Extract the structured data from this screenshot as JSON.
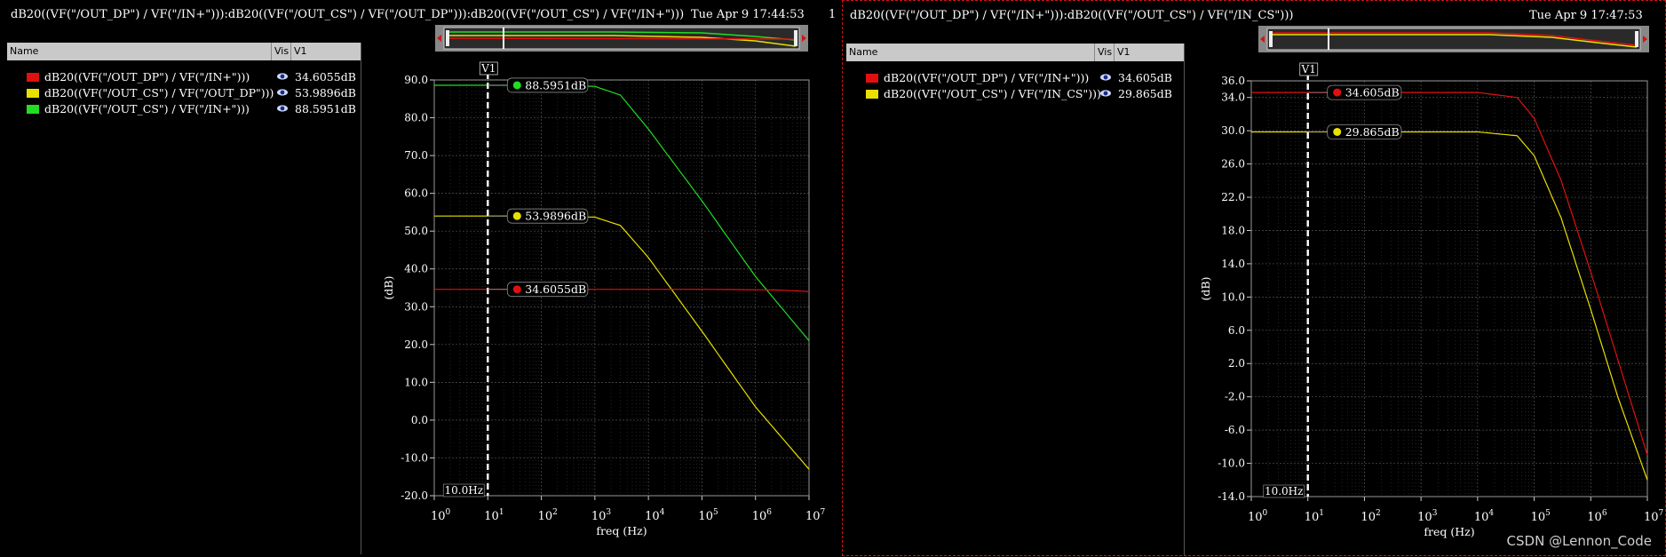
{
  "left": {
    "title": "dB20((VF(\"/OUT_DP\") / VF(\"/IN+\"))):dB20((VF(\"/OUT_CS\") / VF(\"/OUT_DP\"))):dB20((VF(\"/OUT_CS\") / VF(\"/IN+\")))",
    "date": "Tue Apr 9 17:44:53",
    "number": "1",
    "header": {
      "name": "Name",
      "vis": "Vis",
      "v1": "V1"
    },
    "legend": [
      {
        "label": "dB20((VF(\"/OUT_DP\") / VF(\"/IN+\")))",
        "value": "34.6055dB",
        "color": "#e01010"
      },
      {
        "label": "dB20((VF(\"/OUT_CS\") / VF(\"/OUT_DP\")))",
        "value": "53.9896dB",
        "color": "#e8e000"
      },
      {
        "label": "dB20((VF(\"/OUT_CS\") / VF(\"/IN+\")))",
        "value": "88.5951dB",
        "color": "#22dd22"
      }
    ]
  },
  "right": {
    "title": "dB20((VF(\"/OUT_DP\") / VF(\"/IN+\"))):dB20((VF(\"/OUT_CS\") / VF(\"/IN_CS\")))",
    "date": "Tue Apr 9 17:47:53",
    "header": {
      "name": "Name",
      "vis": "Vis",
      "v1": "V1"
    },
    "legend": [
      {
        "label": "dB20((VF(\"/OUT_DP\") / VF(\"/IN+\")))",
        "value": "34.605dB",
        "color": "#e01010"
      },
      {
        "label": "dB20((VF(\"/OUT_CS\") / VF(\"/IN_CS\")))",
        "value": "29.865dB",
        "color": "#e8e000"
      }
    ]
  },
  "watermark": "CSDN @Lennon_Code",
  "chart_data": [
    {
      "type": "line",
      "xlabel": "freq (Hz)",
      "ylabel": "(dB)",
      "xscale": "log",
      "xlim": [
        1,
        10000000
      ],
      "ylim": [
        -20,
        90
      ],
      "yticks": [
        "90.0",
        "80.0",
        "70.0",
        "60.0",
        "50.0",
        "40.0",
        "30.0",
        "20.0",
        "10.0",
        "0.0",
        "-10.0",
        "-20.0"
      ],
      "xticks": [
        "10^0",
        "10^1",
        "10^2",
        "10^3",
        "10^4",
        "10^5",
        "10^6",
        "10^7"
      ],
      "marker": {
        "name": "V1",
        "x": 10,
        "x_label": "10.0Hz"
      },
      "annotations": [
        "88.5951dB",
        "53.9896dB",
        "34.6055dB"
      ],
      "series": [
        {
          "color": "#22dd22",
          "x": [
            1,
            100,
            1000,
            3000,
            10000,
            100000,
            1000000,
            10000000
          ],
          "y": [
            88.6,
            88.6,
            88.3,
            86.0,
            77.0,
            58.0,
            38.0,
            21.0
          ]
        },
        {
          "color": "#e8e000",
          "x": [
            1,
            100,
            1000,
            3000,
            10000,
            100000,
            1000000,
            10000000
          ],
          "y": [
            54.0,
            54.0,
            53.7,
            51.5,
            43.0,
            23.5,
            3.5,
            -13.0
          ]
        },
        {
          "color": "#e01010",
          "x": [
            1,
            100,
            100000,
            1000000,
            3000000,
            10000000
          ],
          "y": [
            34.6,
            34.6,
            34.6,
            34.5,
            34.4,
            34.0
          ]
        }
      ]
    },
    {
      "type": "line",
      "xlabel": "freq (Hz)",
      "ylabel": "(dB)",
      "xscale": "log",
      "xlim": [
        1,
        10000000
      ],
      "ylim": [
        -14,
        36
      ],
      "yticks": [
        "36.0",
        "34.0",
        "30.0",
        "26.0",
        "22.0",
        "18.0",
        "14.0",
        "10.0",
        "6.0",
        "2.0",
        "-2.0",
        "-6.0",
        "-10.0",
        "-14.0"
      ],
      "xticks": [
        "10^0",
        "10^1",
        "10^2",
        "10^3",
        "10^4",
        "10^5",
        "10^6",
        "10^7"
      ],
      "marker": {
        "name": "V1",
        "x": 10,
        "x_label": "10.0Hz"
      },
      "annotations": [
        "34.605dB",
        "29.865dB"
      ],
      "series": [
        {
          "color": "#e01010",
          "x": [
            1,
            10000,
            50000,
            100000,
            300000,
            1000000,
            3000000,
            10000000
          ],
          "y": [
            34.6,
            34.6,
            34.0,
            31.5,
            24.0,
            13.0,
            2.5,
            -9.0
          ]
        },
        {
          "color": "#e8e000",
          "x": [
            1,
            10000,
            50000,
            100000,
            300000,
            1000000,
            3000000,
            10000000
          ],
          "y": [
            29.86,
            29.86,
            29.4,
            27.0,
            19.5,
            8.5,
            -2.0,
            -12.0
          ]
        }
      ]
    }
  ]
}
